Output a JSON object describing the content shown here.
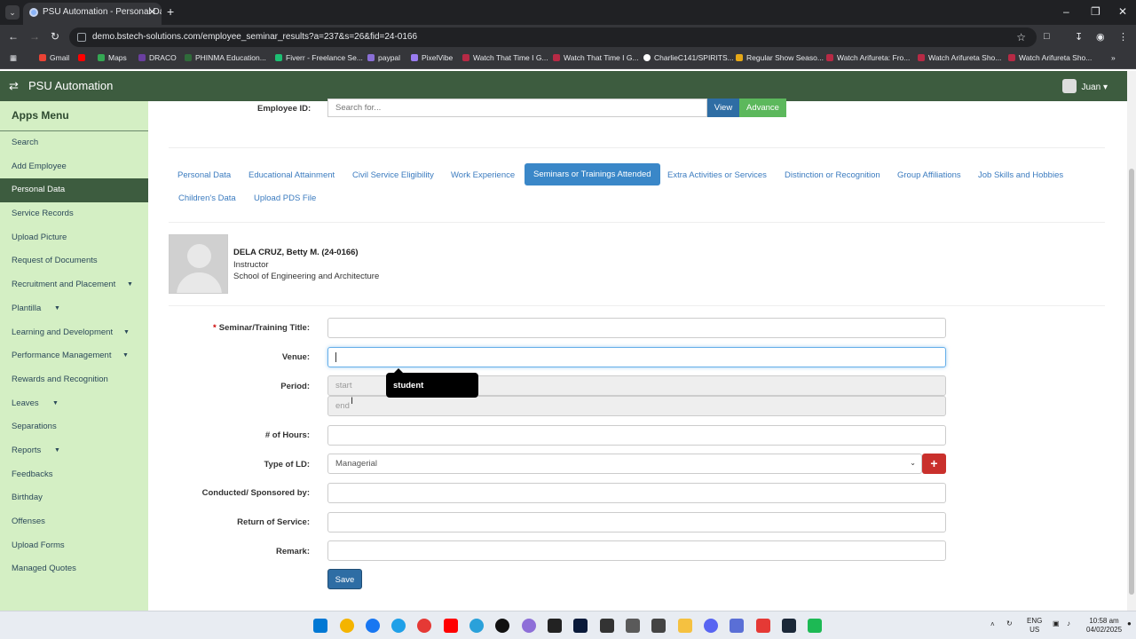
{
  "browser": {
    "tab_title": "PSU Automation - Personal Dat",
    "url": "demo.bstech-solutions.com/employee_seminar_results?a=237&s=26&fid=24-0166",
    "bookmarks": [
      {
        "label": "Gmail",
        "color": "#ea4335"
      },
      {
        "label": "",
        "color": "#ff0000"
      },
      {
        "label": "Maps",
        "color": "#34a853"
      },
      {
        "label": "DRACO",
        "color": "#6a3fa0"
      },
      {
        "label": "PHINMA Education...",
        "color": "#2f6b3a"
      },
      {
        "label": "Fiverr - Freelance Se...",
        "color": "#1dbf73"
      },
      {
        "label": "paypal",
        "color": "#8a6fd6"
      },
      {
        "label": "PixelVibe",
        "color": "#9a7cf0"
      },
      {
        "label": "Watch That Time I G...",
        "color": "#b72a45"
      },
      {
        "label": "Watch That Time I G...",
        "color": "#b72a45"
      },
      {
        "label": "CharlieC141/SPIRITS...",
        "color": "#ffffff"
      },
      {
        "label": "Regular Show Seaso...",
        "color": "#e6a817"
      },
      {
        "label": "Watch Arifureta: Fro...",
        "color": "#b72a45"
      },
      {
        "label": "Watch Arifureta Sho...",
        "color": "#b72a45"
      },
      {
        "label": "Watch Arifureta Sho...",
        "color": "#b72a45"
      }
    ]
  },
  "app": {
    "title": "PSU Automation",
    "user": "Juan"
  },
  "sidebar": {
    "heading": "Apps Menu",
    "items": [
      {
        "label": "Search"
      },
      {
        "label": "Add Employee"
      },
      {
        "label": "Personal Data"
      },
      {
        "label": "Service Records"
      },
      {
        "label": "Upload Picture"
      },
      {
        "label": "Request of Documents"
      },
      {
        "label": "Recruitment and Placement"
      },
      {
        "label": "Plantilla"
      },
      {
        "label": "Learning and Development"
      },
      {
        "label": "Performance Management"
      },
      {
        "label": "Rewards and Recognition"
      },
      {
        "label": "Leaves"
      },
      {
        "label": "Separations"
      },
      {
        "label": "Reports"
      },
      {
        "label": "Feedbacks"
      },
      {
        "label": "Birthday"
      },
      {
        "label": "Offenses"
      },
      {
        "label": "Upload Forms"
      },
      {
        "label": "Managed Quotes"
      }
    ]
  },
  "search": {
    "label": "Employee ID:",
    "placeholder": "Search for...",
    "view_label": "View",
    "advance_label": "Advance"
  },
  "tabs": [
    "Personal Data",
    "Educational Attainment",
    "Civil Service Eligibility",
    "Work Experience",
    "Seminars or Trainings Attended",
    "Extra Activities or Services",
    "Distinction or Recognition",
    "Group Affiliations",
    "Job Skills and Hobbies",
    "Children's Data",
    "Upload PDS File"
  ],
  "employee": {
    "name": "DELA CRUZ, Betty M. (24-0166)",
    "position": "Instructor",
    "school": "School of Engineering and Architecture"
  },
  "form": {
    "title_label": "Seminar/Training Title:",
    "venue_label": "Venue:",
    "period_label": "Period:",
    "period_start_placeholder": "start",
    "period_end_placeholder": "end",
    "hours_label": "# of Hours:",
    "type_label": "Type of LD:",
    "type_value": "Managerial",
    "conducted_label": "Conducted/ Sponsored by:",
    "return_label": "Return of Service:",
    "remark_label": "Remark:",
    "save_label": "Save",
    "autocomplete_suggestion": "student"
  },
  "taskbar": {
    "lang": "ENG",
    "region": "US",
    "time": "10:58 am",
    "date": "04/02/2025"
  }
}
